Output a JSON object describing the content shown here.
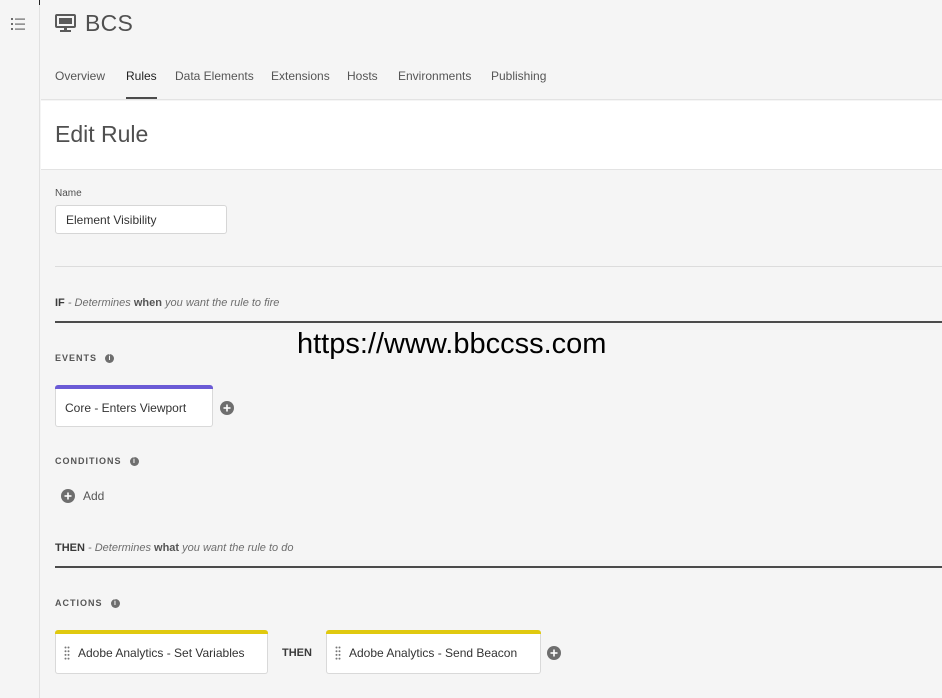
{
  "app": {
    "title": "BCS"
  },
  "nav": {
    "menu_icon": "list-icon",
    "tabs": [
      {
        "label": "Overview",
        "active": false
      },
      {
        "label": "Rules",
        "active": true
      },
      {
        "label": "Data Elements",
        "active": false
      },
      {
        "label": "Extensions",
        "active": false
      },
      {
        "label": "Hosts",
        "active": false
      },
      {
        "label": "Environments",
        "active": false
      },
      {
        "label": "Publishing",
        "active": false
      }
    ]
  },
  "page": {
    "title": "Edit Rule"
  },
  "name_field": {
    "label": "Name",
    "value": "Element Visibility"
  },
  "if_clause": {
    "keyword": "IF",
    "text_before": " - Determines ",
    "emphasis": "when",
    "text_after": " you want the rule to fire"
  },
  "events": {
    "label": "EVENTS",
    "items": [
      {
        "label": "Core - Enters Viewport",
        "color": "#6b5bd6"
      }
    ]
  },
  "conditions": {
    "label": "CONDITIONS",
    "add_label": "Add"
  },
  "then_clause": {
    "keyword": "THEN",
    "text_before": " - Determines ",
    "emphasis": "what",
    "text_after": " you want the rule to do"
  },
  "actions": {
    "label": "ACTIONS",
    "items": [
      {
        "label": "Adobe Analytics - Set Variables",
        "color": "#e0c90f"
      },
      {
        "label": "Adobe Analytics - Send Beacon",
        "color": "#e0c90f"
      }
    ],
    "separator": "THEN"
  },
  "watermark": "https://www.bbccss.com",
  "colors": {
    "background": "#f5f5f5",
    "divider": "#4b4b4b",
    "events_accent": "#6b5bd6",
    "actions_accent": "#e0c90f"
  }
}
